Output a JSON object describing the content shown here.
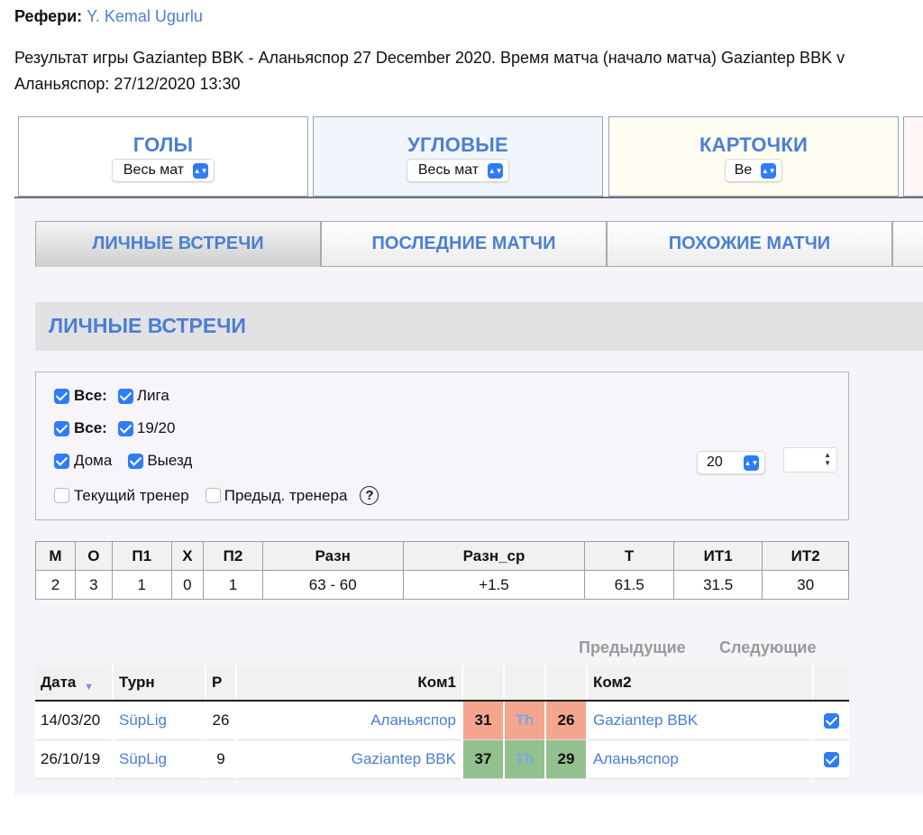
{
  "referee": {
    "label": "Рефери:",
    "name": "Y. Kemal Ugurlu"
  },
  "description": "Результат игры Gaziantep BBK - Аланьяспор 27 December 2020. Время матча (начало матча) Gaziantep BBK v Аланьяспор: 27/12/2020 13:30",
  "stat_boxes": [
    {
      "title": "ГОЛЫ",
      "select": "Весь мат",
      "bg": "#ffffff"
    },
    {
      "title": "УГЛОВЫЕ",
      "select": "Весь мат",
      "bg": "#f1f6fd"
    },
    {
      "title": "КАРТОЧКИ",
      "select": "Ве",
      "bg": "#fffdf2"
    }
  ],
  "tabs": [
    "ЛИЧНЫЕ ВСТРЕЧИ",
    "ПОСЛЕДНИЕ МАТЧИ",
    "ПОХОЖИЕ МАТЧИ"
  ],
  "section_title": "ЛИЧНЫЕ ВСТРЕЧИ",
  "filters": {
    "all1": "Все:",
    "league": "Лига",
    "all2": "Все:",
    "season": "19/20",
    "home": "Дома",
    "away": "Выезд",
    "count_select": "20",
    "current_coach": "Текущий тренер",
    "prev_coach": "Предыд. тренера",
    "help": "?"
  },
  "summary": {
    "headers": [
      "М",
      "О",
      "П1",
      "Х",
      "П2",
      "Разн",
      "Разн_ср",
      "Т",
      "ИТ1",
      "ИТ2"
    ],
    "values": [
      "2",
      "3",
      "1",
      "0",
      "1",
      "63 - 60",
      "+1.5",
      "61.5",
      "31.5",
      "30"
    ]
  },
  "pager": {
    "prev": "Предыдущие",
    "next": "Следующие"
  },
  "matches": {
    "headers": {
      "date": "Дата",
      "tourn": "Турн",
      "round": "Р",
      "team1": "Ком1",
      "team2": "Ком2"
    },
    "sort_icon": "triangle-down",
    "rows": [
      {
        "date": "14/03/20",
        "tourn": "SüpLig",
        "round": "26",
        "team1": "Аланьяспор",
        "score1": "31",
        "mid": "Th",
        "score2": "26",
        "team2": "Gaziantep BBK",
        "color": "red"
      },
      {
        "date": "26/10/19",
        "tourn": "SüpLig",
        "round": "9",
        "team1": "Gaziantep BBK",
        "score1": "37",
        "mid": "Th",
        "score2": "29",
        "team2": "Аланьяспор",
        "color": "green"
      }
    ]
  }
}
